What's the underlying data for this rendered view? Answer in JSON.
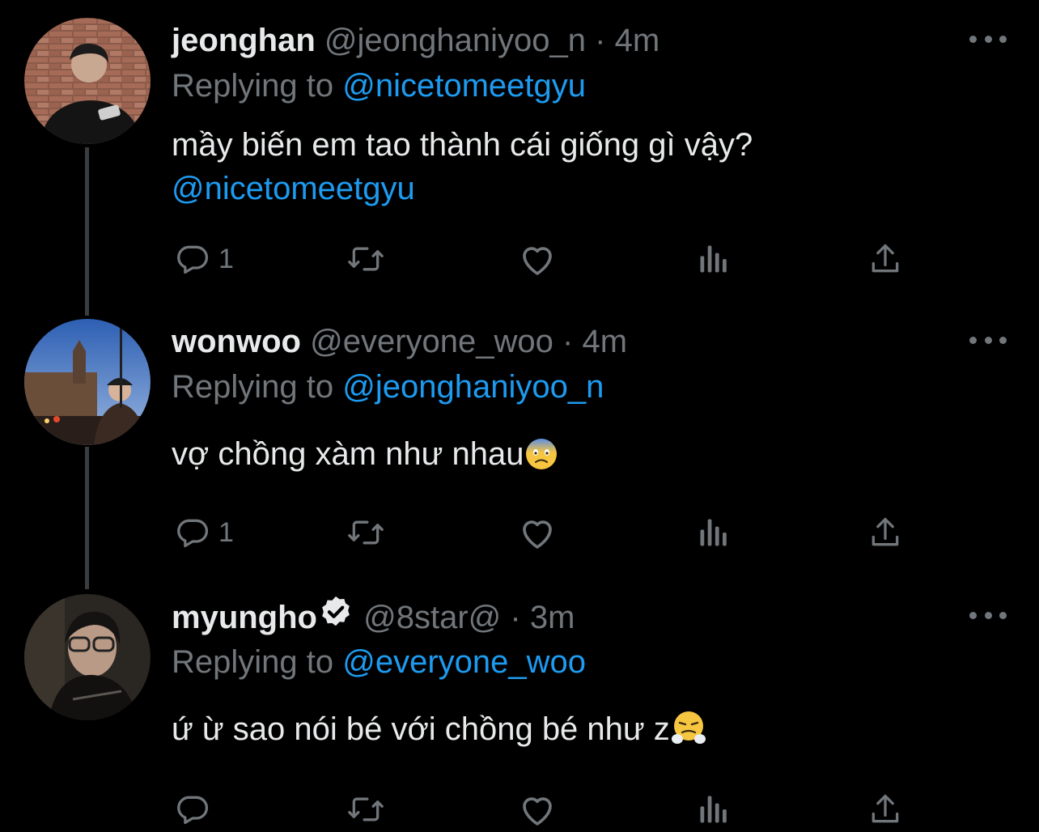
{
  "tweets": [
    {
      "name": "jeonghan",
      "handle": "@jeonghaniyoo_n",
      "time": "4m",
      "replying_prefix": "Replying to",
      "replying_to": "@nicetomeetgyu",
      "text": "mầy biến em tao thành cái giống gì vậy?",
      "text_mention": "@nicetomeetgyu",
      "reply_count": "1",
      "verified": false
    },
    {
      "name": "wonwoo",
      "handle": "@everyone_woo",
      "time": "4m",
      "replying_prefix": "Replying to",
      "replying_to": "@jeonghaniyoo_n",
      "text": "vợ chồng xàm như nhau",
      "emoji": "anxious-face-emoji",
      "reply_count": "1",
      "verified": false
    },
    {
      "name": "myungho",
      "handle": "@8star@",
      "time": "3m",
      "replying_prefix": "Replying to",
      "replying_to": "@everyone_woo",
      "text": "ứ ừ sao nói bé với chồng bé như z",
      "emoji": "steam-from-nose-emoji",
      "reply_count": "",
      "verified": true
    }
  ],
  "separator": "·",
  "colors": {
    "background": "#000000",
    "text": "#e7e9ea",
    "muted": "#71767b",
    "accent": "#1d9bf0",
    "thread_line": "#3a3d40"
  },
  "icons": [
    "reply-icon",
    "retweet-icon",
    "like-icon",
    "views-icon",
    "share-icon",
    "more-icon",
    "verified-badge-icon"
  ]
}
